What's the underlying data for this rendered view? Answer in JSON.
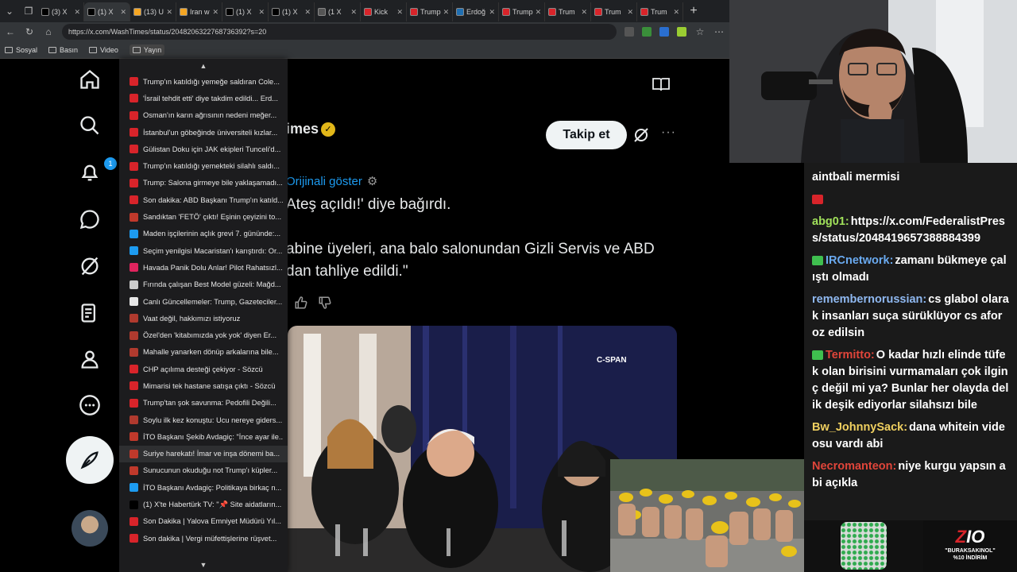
{
  "browser": {
    "url": "https://x.com/WashTimes/status/2048206322768736392?s=20",
    "tabs": [
      {
        "label": "(3) X",
        "color": "#000000"
      },
      {
        "label": "(1) X",
        "color": "#000000",
        "active": true
      },
      {
        "label": "(13) U",
        "color": "#f5a623"
      },
      {
        "label": "Iran w",
        "color": "#f5a623"
      },
      {
        "label": "(1) X",
        "color": "#000000"
      },
      {
        "label": "(1) X",
        "color": "#000000"
      },
      {
        "label": "(1 X",
        "color": "#555555"
      },
      {
        "label": "Kick",
        "color": "#d8242a"
      },
      {
        "label": "Trump",
        "color": "#d8242a"
      },
      {
        "label": "Erdoğ",
        "color": "#1f6fb2"
      },
      {
        "label": "Trump",
        "color": "#d8242a"
      },
      {
        "label": "Trum",
        "color": "#d8242a"
      },
      {
        "label": "Trum",
        "color": "#d8242a"
      },
      {
        "label": "Trum",
        "color": "#d8242a"
      }
    ],
    "bookmarks": [
      "Sosyal",
      "Basın",
      "Video",
      "Yayın"
    ]
  },
  "tab_list": {
    "items": [
      {
        "title": "Trump'ın katıldığı yemeğe saldıran Cole...",
        "color": "#d8242a"
      },
      {
        "title": "'İsrail tehdit etti' diye takdim edildi... Erd...",
        "color": "#d8242a"
      },
      {
        "title": "Osman'ın karın ağrısının nedeni meğer...",
        "color": "#d8242a"
      },
      {
        "title": "İstanbul'un göbeğinde üniversiteli kızlar...",
        "color": "#d8242a"
      },
      {
        "title": "Gülistan Doku için JAK ekipleri Tunceli'd...",
        "color": "#d8242a"
      },
      {
        "title": "Trump'ın katıldığı yemekteki silahlı saldı...",
        "color": "#d8242a"
      },
      {
        "title": "Trump: Salona girmeye bile yaklaşamadı...",
        "color": "#d8242a"
      },
      {
        "title": "Son dakika: ABD Başkanı Trump'ın katıld...",
        "color": "#d8242a"
      },
      {
        "title": "Sandıktan 'FETÖ' çıktı! Eşinin çeyizini to...",
        "color": "#c0392b"
      },
      {
        "title": "Maden işçilerinin açlık grevi 7. gününde:...",
        "color": "#1d9bf0"
      },
      {
        "title": "Seçim yenilgisi Macaristan'ı karıştırdı: Or...",
        "color": "#1d9bf0"
      },
      {
        "title": "Havada Panik Dolu Anlar! Pilot Rahatsızl...",
        "color": "#e0245e"
      },
      {
        "title": "Fırında çalışan Best Model güzeli: Mağd...",
        "color": "#cccccc"
      },
      {
        "title": "Canlı Güncellemeler: Trump, Gazeteciler...",
        "color": "#e6e6e6"
      },
      {
        "title": "Vaat değil, hakkımızı istiyoruz",
        "color": "#b03a2e"
      },
      {
        "title": "Özel'den 'kitabımızda yok yok' diyen Er...",
        "color": "#b03a2e"
      },
      {
        "title": "Mahalle yanarken dönüp arkalarına bile...",
        "color": "#b03a2e"
      },
      {
        "title": "CHP açılıma desteği çekiyor - Sözcü",
        "color": "#d8242a"
      },
      {
        "title": "Mimarisi tek hastane satışa çıktı - Sözcü",
        "color": "#d8242a"
      },
      {
        "title": "Trump'tan şok savunma: Pedofili Değili...",
        "color": "#d8242a"
      },
      {
        "title": "Soylu ilk kez konuştu: Ucu nereye giders...",
        "color": "#b03a2e"
      },
      {
        "title": "İTO Başkanı Şekib Avdagiç: \"İnce ayar ile...",
        "color": "#c0392b"
      },
      {
        "title": "Suriye harekatı! İmar ve inşa dönemi ba...",
        "color": "#c0392b",
        "hover": true
      },
      {
        "title": "Sunucunun okuduğu not Trump'ı küpler...",
        "color": "#c0392b"
      },
      {
        "title": "İTO Başkanı Avdagiç: Politikaya birkaç n...",
        "color": "#1d9bf0"
      },
      {
        "title": "(1) X'te Habertürk TV: \"📌 Site aidatların...",
        "color": "#000000"
      },
      {
        "title": "Son Dakika | Yalova Emniyet Müdürü Yıl...",
        "color": "#d8242a"
      },
      {
        "title": "Son dakika | Vergi müfettişlerine rüşvet...",
        "color": "#d8242a"
      }
    ]
  },
  "xnav": {
    "notification_count": "1"
  },
  "post": {
    "author_fragment": "imes",
    "follow_label": "Takip et",
    "more_label": "···",
    "translate_label": "Orijinali göster",
    "line1": "Ateş açıldı!' diye bağırdı.",
    "line2a": "abine üyeleri, ana balo salonundan Gizli Servis ve ABD",
    "line2b": "dan tahliye edildi.\"",
    "media_label": "C-SPAN"
  },
  "chat": {
    "messages": [
      {
        "user": "",
        "user_color": "#ffffff",
        "text": "aintbali mermisi",
        "chip": ""
      },
      {
        "user": "",
        "user_color": "#ffffff",
        "text": "",
        "chip": "#d8242a"
      },
      {
        "user": "abg01:",
        "user_color": "#a0e05a",
        "text": "https://x.com/FederalistPress/status/2048419657388884399",
        "chip": ""
      },
      {
        "user": "IRCnetwork:",
        "user_color": "#6aaaf0",
        "text": "zamanı bükmeye çalıştı olmadı",
        "chip": "#3fbf4f"
      },
      {
        "user": "remembernorussian:",
        "user_color": "#8fb8f0",
        "text": "cs glabol olarak insanları suça sürüklüyor cs aforoz edilsin",
        "chip": ""
      },
      {
        "user": "Termitto:",
        "user_color": "#e0453a",
        "text": "O kadar hızlı elinde tüfek olan birisini vurmamaları çok ilginç değil mi ya? Bunlar her olayda delik deşik ediyorlar silahsızı bile",
        "chip": "#3fbf4f"
      },
      {
        "user": "Bw_JohnnySack:",
        "user_color": "#f0d060",
        "text": "dana whitein videosu vardı abi",
        "chip": ""
      },
      {
        "user": "Necromanteon:",
        "user_color": "#e0453a",
        "text": "niye kurgu yapsın abi açıkla",
        "chip": ""
      }
    ]
  },
  "promo": {
    "logo": "ZIO",
    "line1": "\"BURAKSAKINOL\"",
    "line2": "%10 İNDİRİM"
  }
}
